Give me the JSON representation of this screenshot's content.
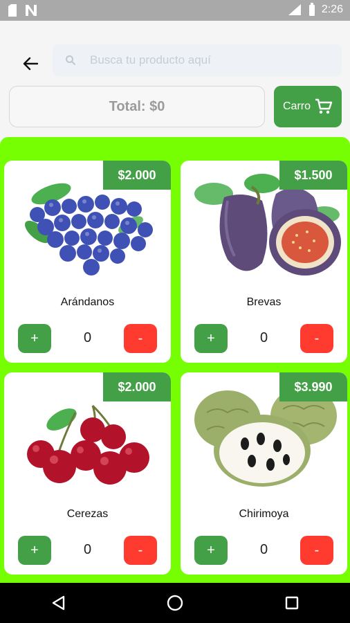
{
  "status": {
    "time": "2:26"
  },
  "search": {
    "placeholder": "Busca tu producto aquí"
  },
  "total": {
    "label": "Total: $0"
  },
  "cart": {
    "label": "Carro"
  },
  "products": [
    {
      "name": "Arándanos",
      "price": "$2.000",
      "qty": "0",
      "plus": "+",
      "minus": "-"
    },
    {
      "name": "Brevas",
      "price": "$1.500",
      "qty": "0",
      "plus": "+",
      "minus": "-"
    },
    {
      "name": "Cerezas",
      "price": "$2.000",
      "qty": "0",
      "plus": "+",
      "minus": "-"
    },
    {
      "name": "Chirimoya",
      "price": "$3.990",
      "qty": "0",
      "plus": "+",
      "minus": "-"
    }
  ],
  "colors": {
    "primary_green": "#43a047",
    "accent_lime": "#76ff03",
    "minus_red": "#ff3b30"
  },
  "icons": {
    "back": "arrow-left-icon",
    "search": "search-icon",
    "cart": "shopping-cart-icon",
    "nav_back": "triangle-back-icon",
    "nav_home": "circle-home-icon",
    "nav_recent": "square-recent-icon"
  }
}
